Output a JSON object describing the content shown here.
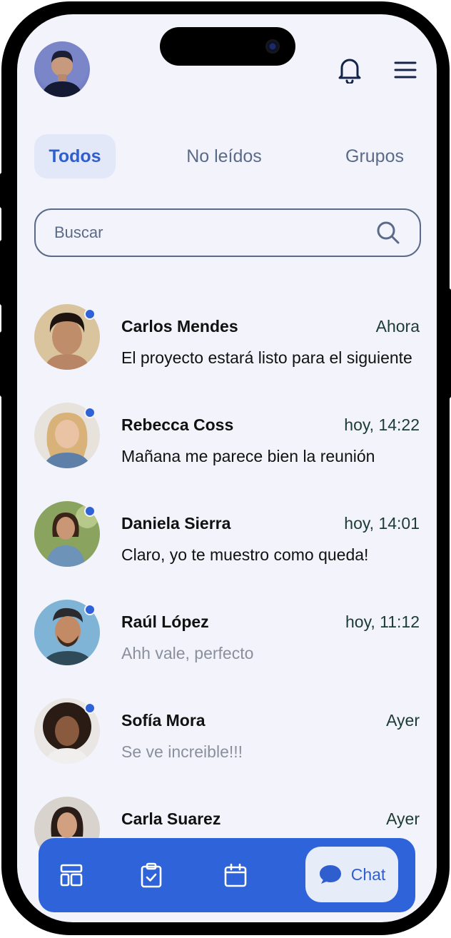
{
  "header": {
    "profile_avatar": "user-profile-photo",
    "notification_icon": "bell-icon",
    "menu_icon": "hamburger-menu-icon"
  },
  "tabs": [
    {
      "label": "Todos",
      "active": true
    },
    {
      "label": "No leídos",
      "active": false
    },
    {
      "label": "Grupos",
      "active": false
    }
  ],
  "search": {
    "placeholder": "Buscar",
    "icon": "search-icon"
  },
  "chats": [
    {
      "name": "Carlos Mendes",
      "time": "Ahora",
      "preview": "El proyecto estará listo para el siguiente",
      "unread": true
    },
    {
      "name": "Rebecca Coss",
      "time": "hoy, 14:22",
      "preview": "Mañana me parece bien la reunión",
      "unread": true
    },
    {
      "name": "Daniela Sierra",
      "time": "hoy, 14:01",
      "preview": "Claro, yo te muestro como queda!",
      "unread": true
    },
    {
      "name": "Raúl López",
      "time": "hoy, 11:12",
      "preview": "Ahh vale, perfecto",
      "unread": false
    },
    {
      "name": "Sofía Mora",
      "time": "Ayer",
      "preview": "Se ve increible!!!",
      "unread": false
    },
    {
      "name": "Carla Suarez",
      "time": "Ayer",
      "preview": "",
      "unread": false
    }
  ],
  "bottom_nav": {
    "items": [
      {
        "icon": "dashboard-icon"
      },
      {
        "icon": "clipboard-check-icon"
      },
      {
        "icon": "calendar-icon"
      }
    ],
    "active": {
      "icon": "chat-bubble-icon",
      "label": "Chat"
    }
  },
  "colors": {
    "accent": "#2f63d9",
    "background": "#f3f4fb",
    "active_tab_bg": "#e2e8f7",
    "online_dot": "#2f62d6"
  }
}
